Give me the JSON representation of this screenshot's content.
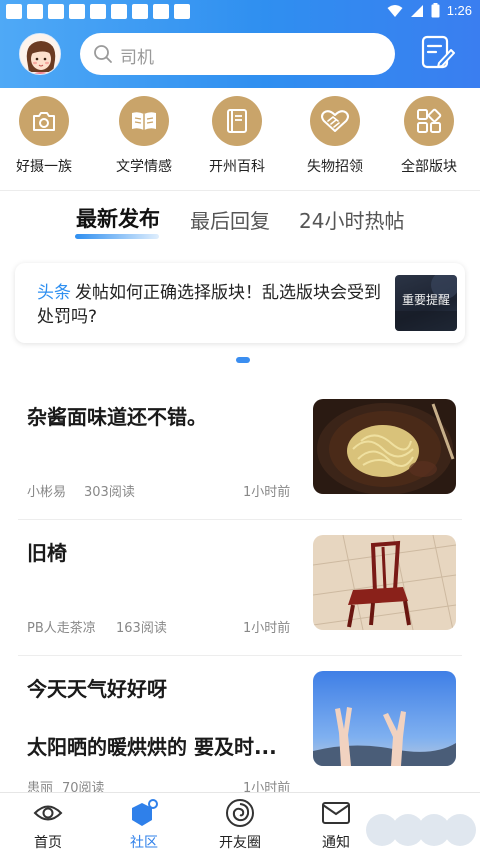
{
  "status_bar": {
    "time": "1:26"
  },
  "header": {
    "search_placeholder": "司机"
  },
  "categories": [
    {
      "label": "好摄一族",
      "icon": "camera-icon"
    },
    {
      "label": "文学情感",
      "icon": "book-open-icon"
    },
    {
      "label": "开州百科",
      "icon": "encyclopedia-icon"
    },
    {
      "label": "失物招领",
      "icon": "handshake-icon"
    },
    {
      "label": "全部版块",
      "icon": "grid-icon"
    }
  ],
  "tabs": [
    {
      "label": "最新发布",
      "active": true
    },
    {
      "label": "最后回复",
      "active": false
    },
    {
      "label": "24小时热帖",
      "active": false
    }
  ],
  "headline": {
    "tag": "头条",
    "text": "发帖如何正确选择版块！乱选版块会受到处罚吗?",
    "thumb_text": "重要提醒"
  },
  "posts": [
    {
      "title": "杂酱面味道还不错。",
      "title2": "",
      "author": "小彬易",
      "views": "303阅读",
      "time": "1小时前"
    },
    {
      "title": "旧椅",
      "title2": "",
      "author": "PB人走茶凉",
      "views": "163阅读",
      "time": "1小时前"
    },
    {
      "title": "今天天气好好呀",
      "title2": "太阳晒的暖烘烘的 要及时...",
      "author": "患丽",
      "views": "70阅读",
      "time": "1小时前"
    }
  ],
  "bottom_nav": [
    {
      "label": "首页",
      "icon": "eye-icon",
      "active": false
    },
    {
      "label": "社区",
      "icon": "hexagon-community-icon",
      "active": true
    },
    {
      "label": "开友圈",
      "icon": "spiral-icon",
      "active": false
    },
    {
      "label": "通知",
      "icon": "envelope-icon",
      "active": false
    }
  ],
  "colors": {
    "brand_blue": "#2f8ff0",
    "category_gold": "#c9a46a",
    "active_nav": "#2f80ea"
  }
}
